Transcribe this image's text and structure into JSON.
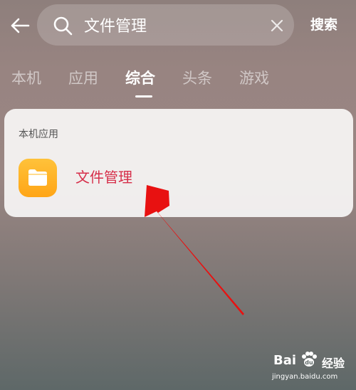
{
  "header": {
    "back_icon": "arrow-left-icon",
    "search": {
      "icon": "search-icon",
      "value": "文件管理",
      "clear_icon": "close-icon",
      "submit_label": "搜索"
    }
  },
  "tabs": [
    {
      "label": "本机",
      "active": false
    },
    {
      "label": "应用",
      "active": false
    },
    {
      "label": "综合",
      "active": true
    },
    {
      "label": "头条",
      "active": false
    },
    {
      "label": "游戏",
      "active": false
    }
  ],
  "results": {
    "section_label": "本机应用",
    "apps": [
      {
        "name": "文件管理",
        "icon": "folder-icon",
        "icon_color": "#ffb020"
      }
    ]
  },
  "annotation": {
    "arrow_color": "#e81111"
  },
  "watermark": {
    "brand": "Bai",
    "brand_suffix": "经验",
    "url": "jingyan.baidu.com"
  },
  "colors": {
    "accent": "#d62f4a",
    "text_light": "#ffffff"
  }
}
